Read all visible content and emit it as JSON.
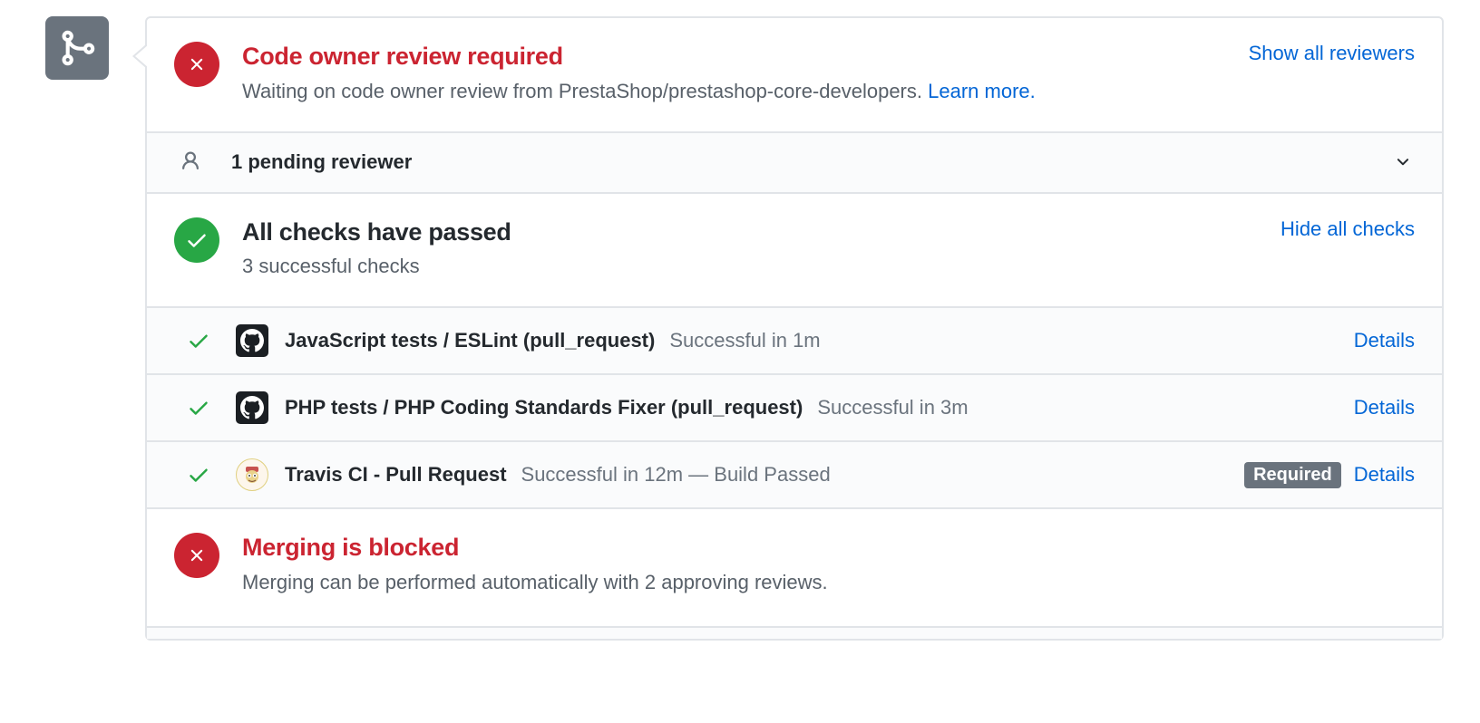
{
  "review": {
    "title": "Code owner review required",
    "desc_prefix": "Waiting on code owner review from PrestaShop/prestashop-core-developers. ",
    "learn_more": "Learn more.",
    "show_all": "Show all reviewers"
  },
  "pending": {
    "label": "1 pending reviewer"
  },
  "checks_header": {
    "title": "All checks have passed",
    "subtitle": "3 successful checks",
    "toggle": "Hide all checks"
  },
  "checks": [
    {
      "avatar": "github",
      "name": "JavaScript tests / ESLint (pull_request)",
      "result": "Successful in 1m",
      "required": false,
      "details": "Details"
    },
    {
      "avatar": "github",
      "name": "PHP tests / PHP Coding Standards Fixer (pull_request)",
      "result": "Successful in 3m",
      "required": false,
      "details": "Details"
    },
    {
      "avatar": "travis",
      "name": "Travis CI - Pull Request",
      "result": "Successful in 12m — Build Passed",
      "required": true,
      "required_label": "Required",
      "details": "Details"
    }
  ],
  "blocked": {
    "title": "Merging is blocked",
    "desc": "Merging can be performed automatically with 2 approving reviews."
  }
}
